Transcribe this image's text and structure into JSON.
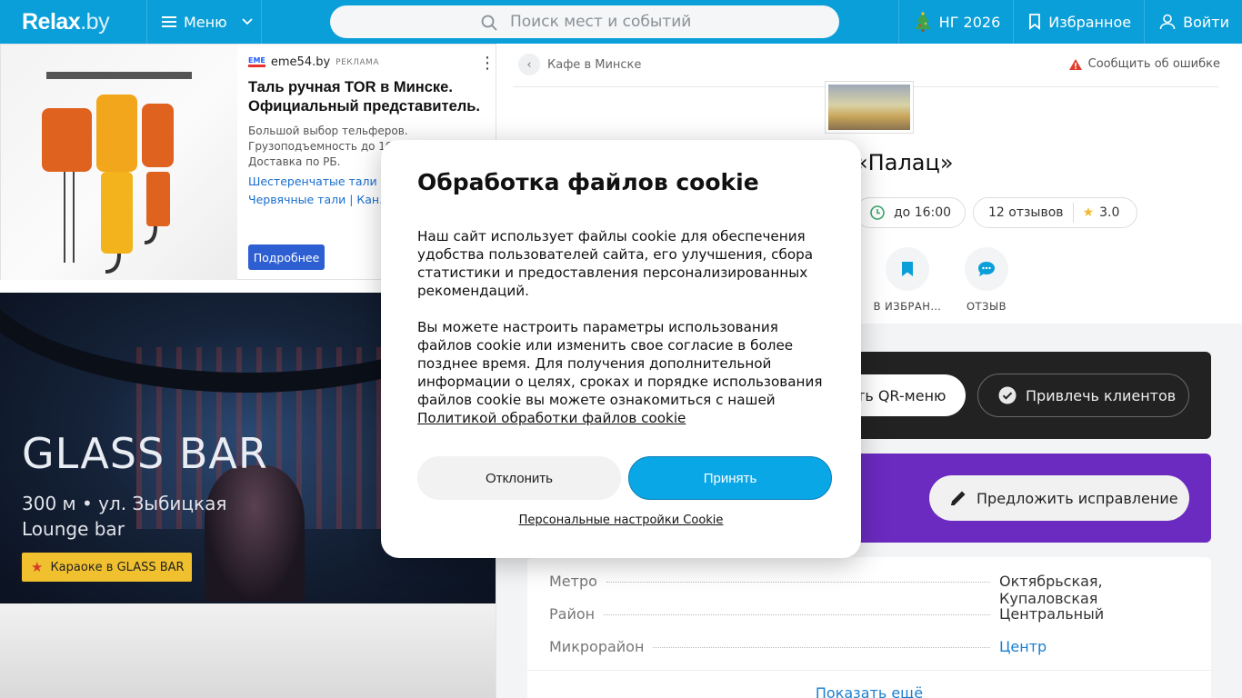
{
  "header": {
    "logo_main": "Relax",
    "logo_suffix": ".by",
    "menu_label": "Меню",
    "search_placeholder": "Поиск мест и событий",
    "ny_label": "НГ 2026",
    "favorites_label": "Избранное",
    "login_label": "Войти",
    "brand_color": "#0a9fd8"
  },
  "ad": {
    "source": "eme54.by",
    "source_logo": "EME",
    "badge": "РЕКЛАМА",
    "title": "Таль ручная TOR в Минске. Официальный представитель.",
    "description": "Большой выбор тельферов. Грузоподъемность до 10… цены. Доставка по РБ.",
    "links_row1": "Шестеренчатые тали   |",
    "links_row2": "Червячные тали   |   Кан…",
    "button": "Подробнее"
  },
  "promo": {
    "title": "GLASS BAR",
    "distance_street": "300 м • ул. Зыбицкая",
    "category": "Lounge bar",
    "badge": "Караоке в GLASS BAR"
  },
  "page": {
    "breadcrumb": "Кафе в Минске",
    "report_error": "Сообщить об ошибке",
    "place_name_visible": "«Палац»",
    "hours": "до 16:00",
    "reviews": "12 отзывов",
    "rating": "3.0",
    "actions": [
      {
        "label": "В ИЗБРАН…",
        "icon": "bookmark-icon"
      },
      {
        "label": "ОТЗЫВ",
        "icon": "chat-icon"
      }
    ],
    "qr_menu": "ть QR-меню",
    "attract_clients": "Привлечь клиентов",
    "suggest_edit": "Предложить исправление",
    "info_rows": [
      {
        "key": "Метро",
        "value": "Октябрьская, Купаловская",
        "link": false
      },
      {
        "key": "Район",
        "value": "Центральный",
        "link": false
      },
      {
        "key": "Микрорайон",
        "value": "Центр",
        "link": true
      }
    ],
    "show_more": "Показать ещё"
  },
  "cookie_modal": {
    "title": "Обработка файлов cookie",
    "paragraph1": "Наш сайт использует файлы cookie для обеспечения удобства пользователей сайта, его улучшения, сбора статистики и предоставления персонализированных рекомендаций.",
    "paragraph2": "Вы можете настроить параметры использования файлов cookie или изменить свое согласие в более позднее время. Для получения дополнительной информации о целях, сроках и порядке использования файлов cookie вы можете ознакомиться с нашей",
    "policy_link": "Политикой обработки файлов cookie",
    "decline": "Отклонить",
    "accept": "Принять",
    "personal_settings": "Персональные настройки Cookie",
    "accept_color": "#0aa7e6"
  }
}
